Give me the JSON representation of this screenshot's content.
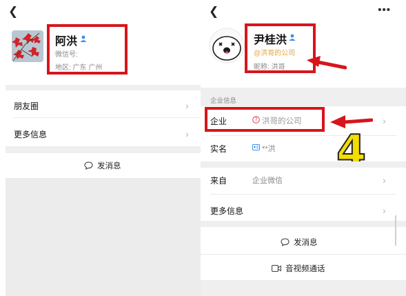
{
  "left": {
    "name": "阿洪",
    "wechat_id_label": "微信号:",
    "region": "地区: 广东 广州",
    "items": [
      {
        "label": "朋友圈"
      },
      {
        "label": "更多信息"
      }
    ],
    "send_message": "发消息"
  },
  "right": {
    "name": "尹桂洪",
    "company_line": "@洪哥的公司",
    "nickname": "昵称: 洪哥",
    "section_title": "企业信息",
    "company_label": "企业",
    "company_value": "洪哥的公司",
    "realname_label": "实名",
    "realname_value": "**洪",
    "from_label": "来自",
    "from_value": "企业微信",
    "more_info": "更多信息",
    "send_message": "发消息",
    "video_call": "音视频通话",
    "annotation_number": "4"
  },
  "colors": {
    "highlight_box": "#d7151c",
    "company_text": "#e3a23a",
    "annotation_number": "#f2de00"
  },
  "icons": [
    "back-icon",
    "more-icon",
    "verify-icon",
    "question-icon",
    "id-card-icon",
    "chat-bubble-icon",
    "video-camera-icon",
    "chevron-right-icon",
    "red-arrow-icon"
  ]
}
